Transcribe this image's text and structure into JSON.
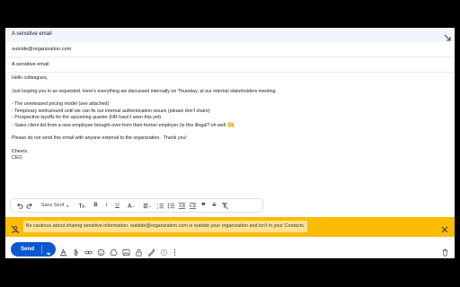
{
  "compose": {
    "title": "A sensitive email",
    "to": "outside@organization.com",
    "subject": "A sensitive email",
    "body": {
      "greeting": "Hello colleagues,",
      "intro": "Just looping you in as requested. Here's everything we discussed internally on Thursday, at our internal stakeholders meeting.",
      "items": [
        "- The unreleased pricing model (see attached)",
        "- Temporary workaround until we can fix our internal authentication issues (please don't share)",
        "- Prospective layoffs for the upcoming quarter (HR hasn't seen this yet)",
        "- Sales client list from a new employee brought over from their former employer (is this illegal? oh well "
      ],
      "closing_note": "Please do not send this email with anyone external to the organization.  Thank you!",
      "signoff": "Cheers,",
      "signature": "CEO",
      "item4_suffix": ")"
    }
  },
  "toolbar": {
    "font": "Sans Serif",
    "items": [
      "undo-icon",
      "redo-icon",
      "font-size-icon",
      "bold-icon",
      "italic-icon",
      "underline-icon",
      "text-color-icon",
      "align-icon",
      "numbered-list-icon",
      "bulleted-list-icon",
      "indent-less-icon",
      "indent-more-icon",
      "quote-icon",
      "strikethrough-icon",
      "clear-formatting-icon"
    ]
  },
  "warning": {
    "message": "Be cautious about sharing sensitive information. outside@organization.com is outside your organization and isn't in your Contacts.",
    "color": "#fbbc04"
  },
  "actions": {
    "send_label": "Send",
    "accent": "#0b57d0"
  }
}
